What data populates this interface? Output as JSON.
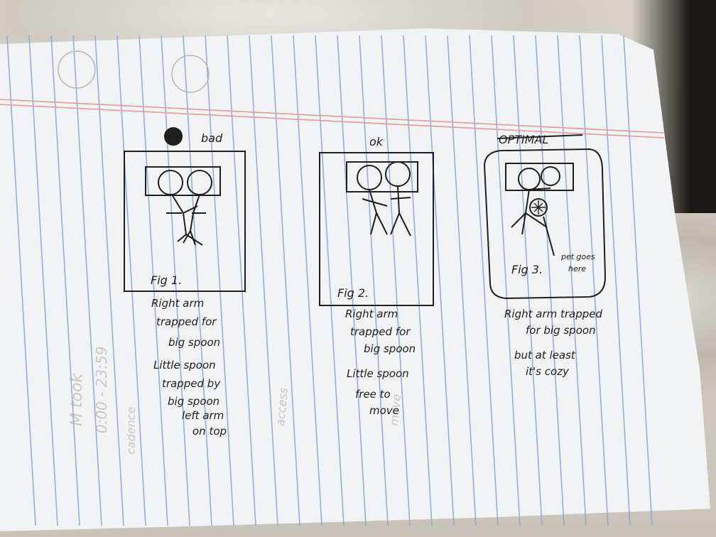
{
  "figures": [
    {
      "rating": "bad",
      "fig_label": "Fig 1.",
      "caption": [
        "Right arm",
        "trapped for",
        "big spoon",
        "Little spoon",
        "trapped by",
        "big spoon",
        "left arm",
        "on top"
      ]
    },
    {
      "rating": "ok",
      "fig_label": "Fig 2.",
      "caption": [
        "Right arm",
        "trapped for",
        "big spoon",
        "Little spoon",
        "free to",
        "move"
      ]
    },
    {
      "rating": "OPTIMAL",
      "fig_label": "Fig 3.",
      "pet_note": [
        "pet goes",
        "here"
      ],
      "caption": [
        "Right arm trapped",
        "for big spoon",
        "but at least",
        "it's cozy"
      ]
    }
  ],
  "colors": {
    "paper": "#f2f3f4",
    "rule_lines": "#8fa6d6",
    "margin_lines": "#e39a9a",
    "ink": "#1e1e1e",
    "bleed_through": "#a9a5a0"
  }
}
